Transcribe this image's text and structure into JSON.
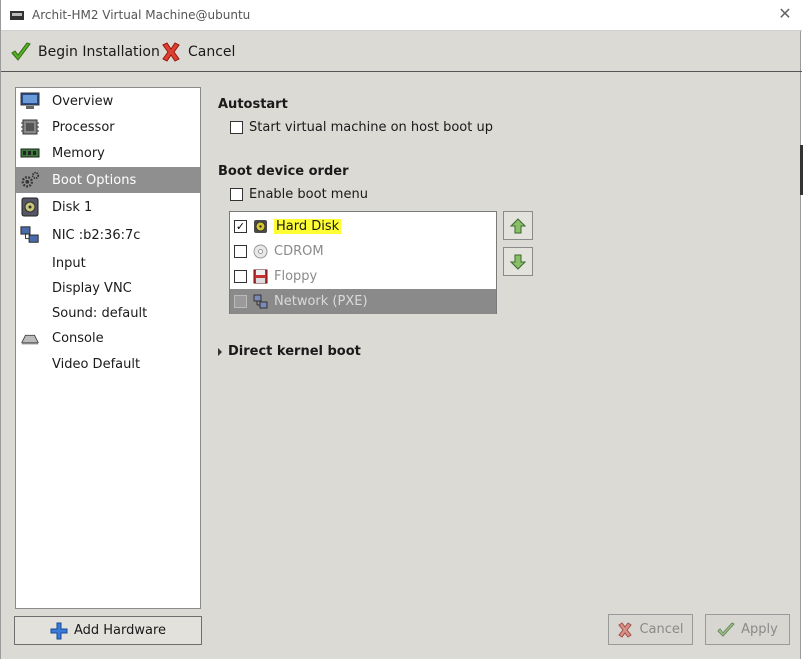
{
  "window": {
    "title": "Archit-HM2 Virtual Machine@ubuntu"
  },
  "toolbar": {
    "begin_label": "Begin Installation",
    "cancel_label": "Cancel"
  },
  "sidebar": {
    "items": [
      {
        "label": "Overview",
        "icon": "monitor-icon"
      },
      {
        "label": "Processor",
        "icon": "cpu-icon"
      },
      {
        "label": "Memory",
        "icon": "memory-icon"
      },
      {
        "label": "Boot Options",
        "icon": "gears-icon",
        "selected": true
      },
      {
        "label": "Disk 1",
        "icon": "disk-icon"
      },
      {
        "label": "NIC :b2:36:7c",
        "icon": "network-icon"
      },
      {
        "label": "Input",
        "icon": ""
      },
      {
        "label": "Display VNC",
        "icon": ""
      },
      {
        "label": "Sound: default",
        "icon": ""
      },
      {
        "label": "Console",
        "icon": "console-icon"
      },
      {
        "label": "Video Default",
        "icon": ""
      }
    ],
    "add_hardware_label": "Add Hardware"
  },
  "autostart": {
    "title": "Autostart",
    "checkbox_label": "Start virtual machine on host boot up",
    "checked": false
  },
  "boot": {
    "title": "Boot device order",
    "enable_menu_label": "Enable boot menu",
    "enable_menu_checked": false,
    "devices": [
      {
        "label": "Hard Disk",
        "checked": true
      },
      {
        "label": "CDROM",
        "checked": false
      },
      {
        "label": "Floppy",
        "checked": false
      },
      {
        "label": "Network (PXE)",
        "checked": false
      }
    ]
  },
  "kernel": {
    "title": "Direct kernel boot"
  },
  "footer": {
    "cancel_label": "Cancel",
    "apply_label": "Apply"
  }
}
